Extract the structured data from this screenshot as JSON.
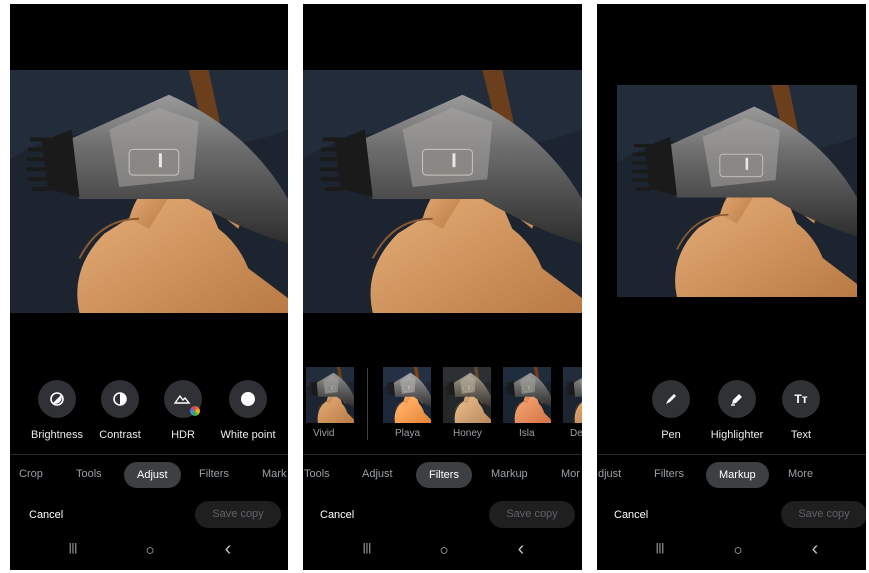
{
  "panels": [
    {
      "tools": [
        {
          "label": "Brightness",
          "icon": "brightness-icon"
        },
        {
          "label": "Contrast",
          "icon": "contrast-icon"
        },
        {
          "label": "HDR",
          "icon": "hdr-icon"
        },
        {
          "label": "White point",
          "icon": "white-point-icon"
        }
      ],
      "tabs": [
        "Crop",
        "Tools",
        "Adjust",
        "Filters",
        "Mark"
      ],
      "active_tab": "Adjust",
      "cancel": "Cancel",
      "save": "Save copy"
    },
    {
      "filters": [
        "Vivid",
        "Playa",
        "Honey",
        "Isla",
        "De"
      ],
      "tabs": [
        "Tools",
        "Adjust",
        "Filters",
        "Markup",
        "Mor"
      ],
      "active_tab": "Filters",
      "cancel": "Cancel",
      "save": "Save copy"
    },
    {
      "tools": [
        {
          "label": "Pen",
          "icon": "pen-icon"
        },
        {
          "label": "Highlighter",
          "icon": "highlighter-icon"
        },
        {
          "label": "Text",
          "icon": "text-icon",
          "glyph": "Tт"
        }
      ],
      "tabs": [
        "djust",
        "Filters",
        "Markup",
        "More"
      ],
      "active_tab": "Markup",
      "cancel": "Cancel",
      "save": "Save copy"
    }
  ],
  "nav": {
    "recents": "|||",
    "home": "○",
    "back": "‹"
  },
  "colors": {
    "panel_bg": "#000000",
    "chip_bg": "#303134",
    "active_tab_bg": "#3c4043",
    "muted_text": "#9aa0a6"
  }
}
